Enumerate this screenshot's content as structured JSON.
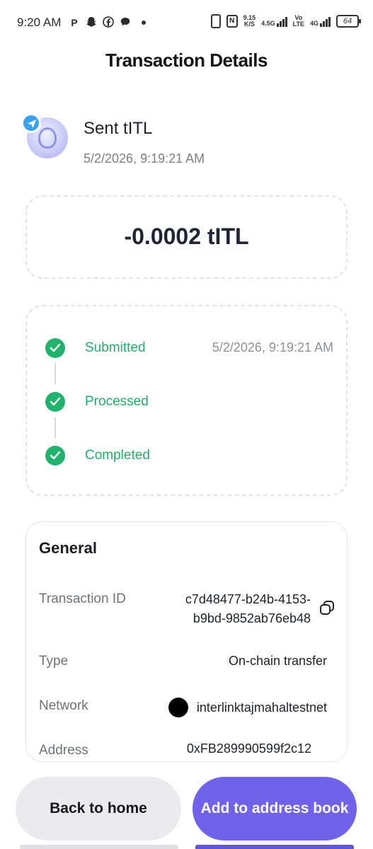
{
  "status_bar": {
    "time": "9:20 AM",
    "left_icons": [
      "p-icon",
      "snapchat-icon",
      "facebook-icon",
      "chat-icon"
    ],
    "speed_value": "9.15",
    "speed_unit": "K/S",
    "net1": "4.5G",
    "net2_top": "Vo",
    "net2_bottom": "LTE",
    "net3": "4G",
    "battery": "64"
  },
  "header": {
    "title": "Transaction Details"
  },
  "transaction": {
    "title": "Sent tITL",
    "datetime": "5/2/2026, 9:19:21 AM",
    "amount": "-0.0002 tITL"
  },
  "timeline": {
    "steps": [
      {
        "label": "Submitted",
        "time": "5/2/2026, 9:19:21 AM"
      },
      {
        "label": "Processed",
        "time": ""
      },
      {
        "label": "Completed",
        "time": ""
      }
    ],
    "status_color": "#21b36b"
  },
  "general": {
    "title": "General",
    "rows": {
      "transaction_id_label": "Transaction ID",
      "transaction_id_line1": "c7d48477-b24b-4153-",
      "transaction_id_line2": "b9bd-9852ab76eb48",
      "type_label": "Type",
      "type_value": "On-chain transfer",
      "network_label": "Network",
      "network_value": "interlinktajmahaltestnet",
      "address_label": "Address",
      "address_value": "0xFB289990599f2c12"
    }
  },
  "buttons": {
    "back_home": "Back to home",
    "add_address": "Add to address book"
  },
  "colors": {
    "accent": "#6e63ea",
    "success": "#21b36b",
    "badge": "#3aa2f0"
  }
}
